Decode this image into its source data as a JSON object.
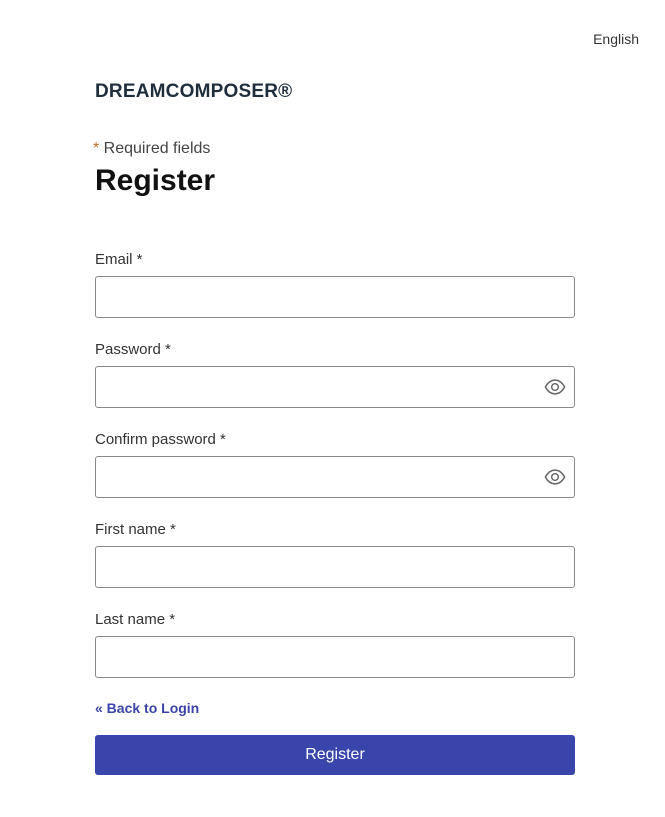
{
  "header": {
    "language": "English"
  },
  "brand": {
    "name": "DREAMCOMPOSER®"
  },
  "form": {
    "required_star": "*",
    "required_note": " Required fields",
    "title": "Register",
    "fields": [
      {
        "label": "Email *",
        "value": "",
        "placeholder": ""
      },
      {
        "label": "Password *",
        "value": "",
        "placeholder": "",
        "icon": "eye-icon"
      },
      {
        "label": "Confirm password *",
        "value": "",
        "placeholder": "",
        "icon": "eye-icon"
      },
      {
        "label": "First name *",
        "value": "",
        "placeholder": ""
      },
      {
        "label": "Last name *",
        "value": "",
        "placeholder": ""
      }
    ],
    "back_link": "« Back to Login",
    "submit_label": "Register"
  },
  "colors": {
    "accent": "#3a45ac",
    "link": "#3b44a8",
    "required_star": "#c0702a"
  }
}
